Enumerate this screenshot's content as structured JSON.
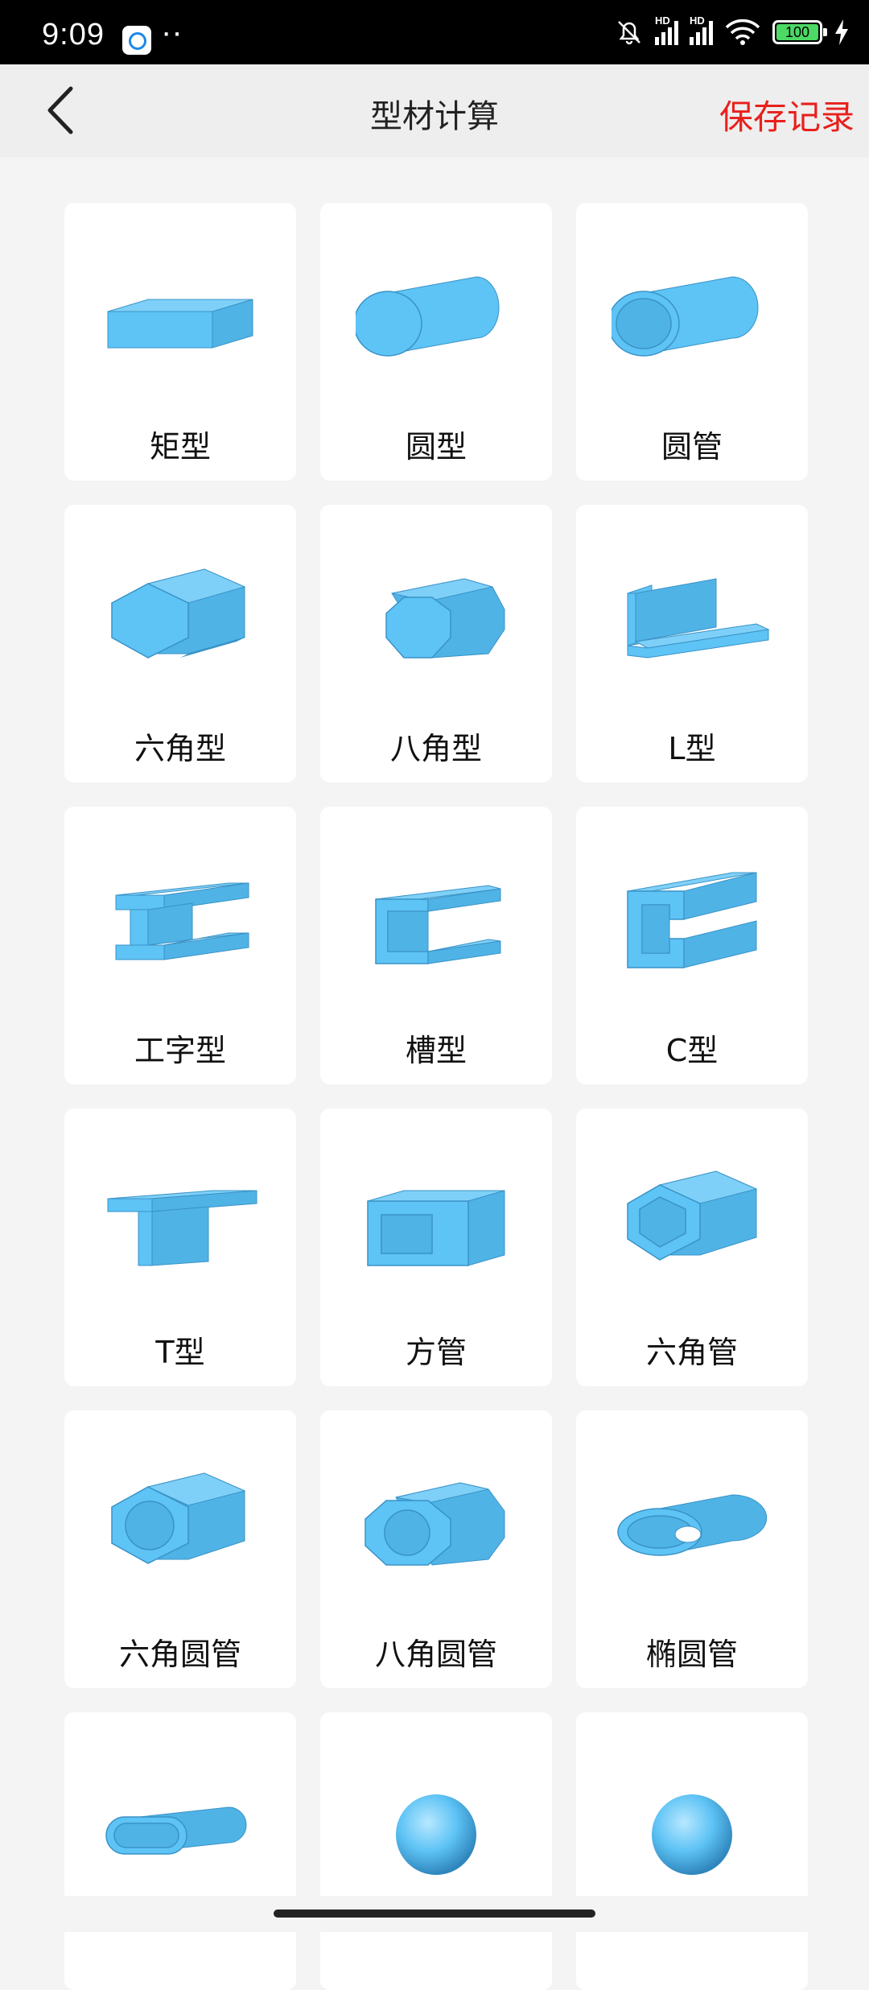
{
  "status_bar": {
    "time": "9:09",
    "dots": "··",
    "hd": "HD",
    "battery": "100"
  },
  "header": {
    "title": "型材计算",
    "save_label": "保存记录"
  },
  "colors": {
    "accent_red": "#e8201c",
    "shape_fill": "#5ec3f5",
    "shape_dark": "#3a93c7"
  },
  "shapes": [
    {
      "label": "矩型",
      "icon": "rectangle-bar-icon"
    },
    {
      "label": "圆型",
      "icon": "round-bar-icon"
    },
    {
      "label": "圆管",
      "icon": "round-tube-icon"
    },
    {
      "label": "六角型",
      "icon": "hexagon-bar-icon"
    },
    {
      "label": "八角型",
      "icon": "octagon-bar-icon"
    },
    {
      "label": "L型",
      "icon": "angle-bar-icon"
    },
    {
      "label": "工字型",
      "icon": "i-beam-icon"
    },
    {
      "label": "槽型",
      "icon": "channel-icon"
    },
    {
      "label": "C型",
      "icon": "c-channel-icon"
    },
    {
      "label": "T型",
      "icon": "t-bar-icon"
    },
    {
      "label": "方管",
      "icon": "square-tube-icon"
    },
    {
      "label": "六角管",
      "icon": "hexagon-tube-icon"
    },
    {
      "label": "六角圆管",
      "icon": "hexagon-round-tube-icon"
    },
    {
      "label": "八角圆管",
      "icon": "octagon-round-tube-icon"
    },
    {
      "label": "椭圆管",
      "icon": "oval-tube-icon"
    },
    {
      "label": "",
      "icon": "flat-oval-tube-icon"
    },
    {
      "label": "",
      "icon": "sphere-icon"
    },
    {
      "label": "",
      "icon": "sphere-icon"
    }
  ]
}
